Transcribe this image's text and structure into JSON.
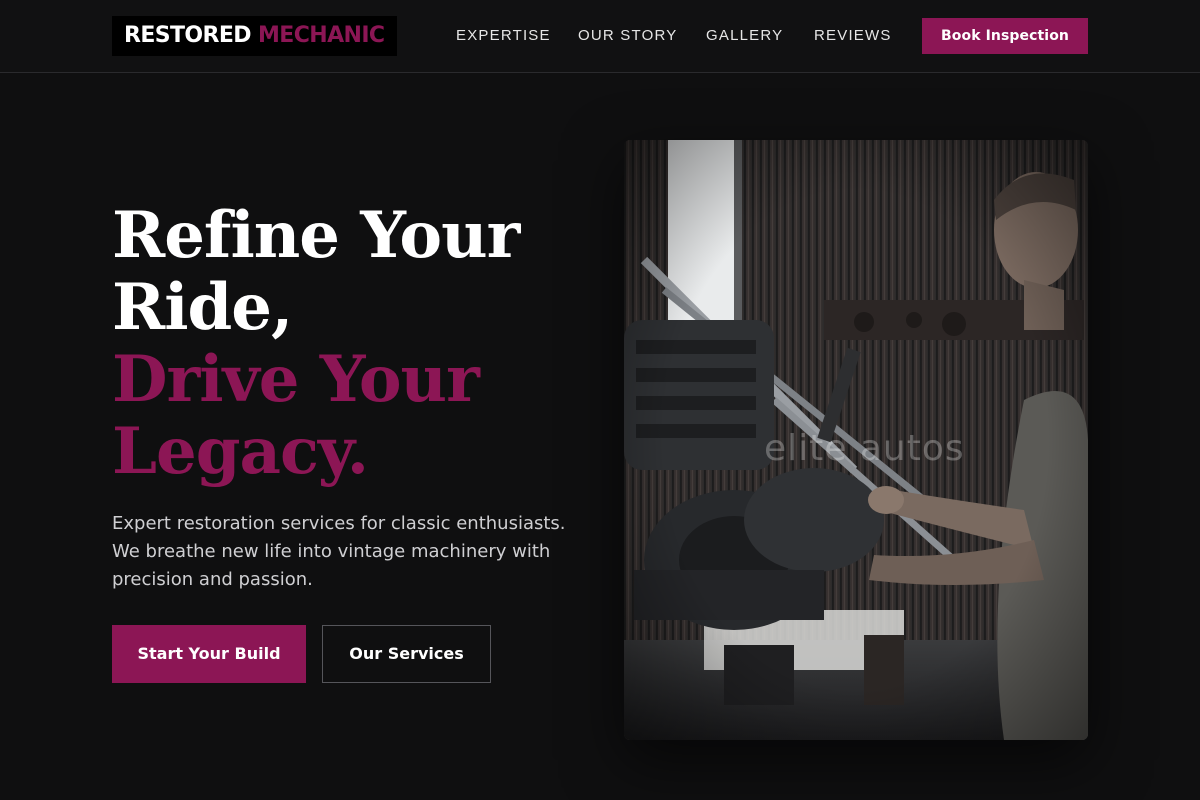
{
  "brand": {
    "name_part1": "RESTORED",
    "name_part2": "MECHANIC",
    "accent_color": "#8c1655"
  },
  "nav": {
    "items": [
      {
        "label": "EXPERTISE"
      },
      {
        "label": "OUR STORY"
      },
      {
        "label": "GALLERY"
      },
      {
        "label": "REVIEWS"
      }
    ],
    "cta_label": "Book Inspection"
  },
  "hero": {
    "headline_line1": "Refine Your",
    "headline_line2": "Ride,",
    "headline_line3": "Drive Your",
    "headline_line4": "Legacy.",
    "description": "Expert restoration services for classic enthusiasts. We breathe new life into vintage machinery with precision and passion.",
    "primary_button": "Start Your Build",
    "secondary_button": "Our Services",
    "image_watermark": "elite autos",
    "image_subject": "mechanic working on a vintage motorcycle engine in a workshop"
  }
}
